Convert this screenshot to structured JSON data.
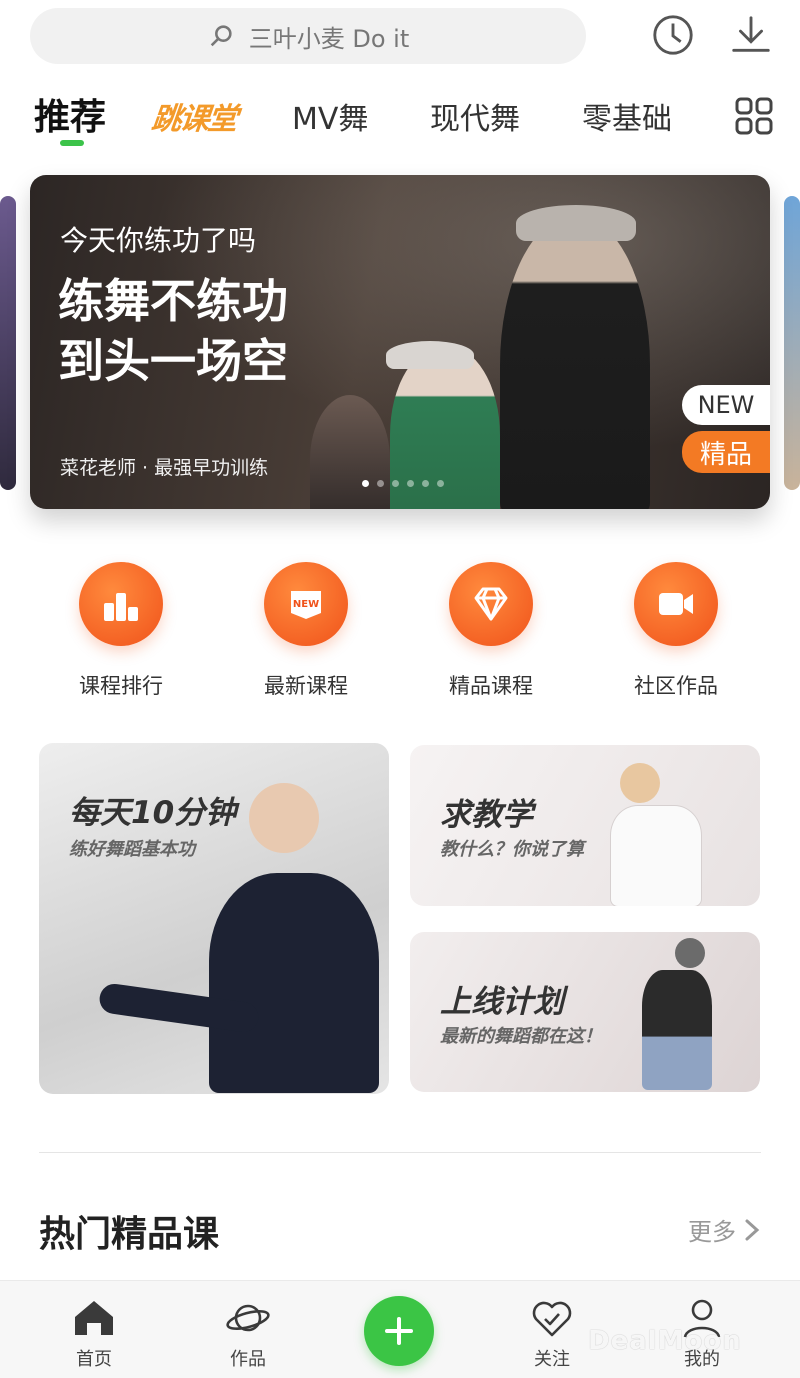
{
  "search": {
    "placeholder": "三叶小麦 Do it"
  },
  "tabs": [
    "推荐",
    "跳课堂",
    "MV舞",
    "现代舞",
    "零基础"
  ],
  "banner": {
    "subtitle": "今天你练功了吗",
    "title_line1": "练舞不练功",
    "title_line2": "到头一场空",
    "caption": "菜花老师 · 最强早功训练",
    "badge_new": "NEW",
    "badge_premium": "精品"
  },
  "quick_entries": [
    "课程排行",
    "最新课程",
    "精品课程",
    "社区作品"
  ],
  "cards": {
    "big": {
      "title": "每天10分钟",
      "subtitle": "练好舞蹈基本功"
    },
    "small1": {
      "title": "求教学",
      "subtitle": "教什么？你说了算"
    },
    "small2": {
      "title": "上线计划",
      "subtitle": "最新的舞蹈都在这！"
    }
  },
  "section": {
    "title": "热门精品课",
    "more": "更多"
  },
  "bottom_nav": {
    "home": "首页",
    "works": "作品",
    "follow": "关注",
    "mine": "我的"
  },
  "watermark": "DealMoon",
  "colors": {
    "accent_green": "#3bc545",
    "accent_orange": "#f0521a",
    "tab_special": "#f39a2a"
  }
}
